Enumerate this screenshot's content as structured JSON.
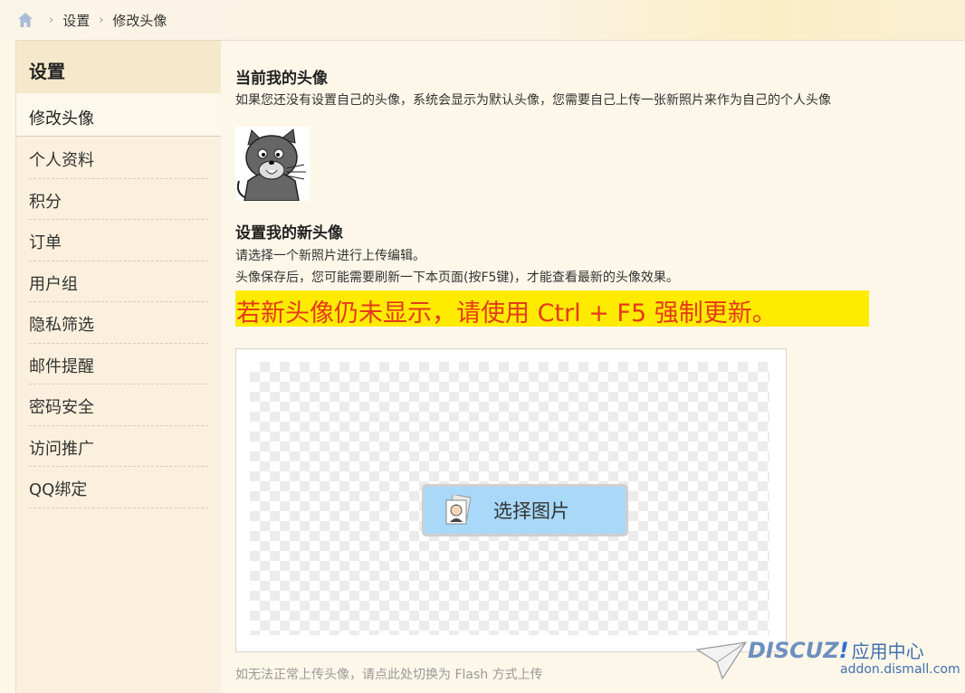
{
  "breadcrumb": {
    "home_icon": "home-icon",
    "items": [
      "设置",
      "修改头像"
    ]
  },
  "sidebar": {
    "title": "设置",
    "active": "修改头像",
    "items": [
      "个人资料",
      "积分",
      "订单",
      "用户组",
      "隐私筛选",
      "邮件提醒",
      "密码安全",
      "访问推广",
      "QQ绑定"
    ]
  },
  "current": {
    "heading": "当前我的头像",
    "desc": "如果您还没有设置自己的头像，系统会显示为默认头像，您需要自己上传一张新照片来作为自己的个人头像"
  },
  "newavatar": {
    "heading": "设置我的新头像",
    "line1": "请选择一个新照片进行上传编辑。",
    "line2": "头像保存后，您可能需要刷新一下本页面(按F5键)，才能查看最新的头像效果。",
    "warning": "若新头像仍未显示，请使用 Ctrl + F5 强制更新。"
  },
  "uploader": {
    "button_label": "选择图片",
    "fallback": "如无法正常上传头像，请点此处切换为 Flash 方式上传"
  },
  "watermark": {
    "brand": "DISCUZ",
    "bang": "!",
    "center": "应用中心",
    "url": "addon.dismall.com"
  },
  "colors": {
    "warning_bg": "#ffeb00",
    "warning_text": "#e53a1a",
    "button_bg": "#a9d8f8"
  }
}
